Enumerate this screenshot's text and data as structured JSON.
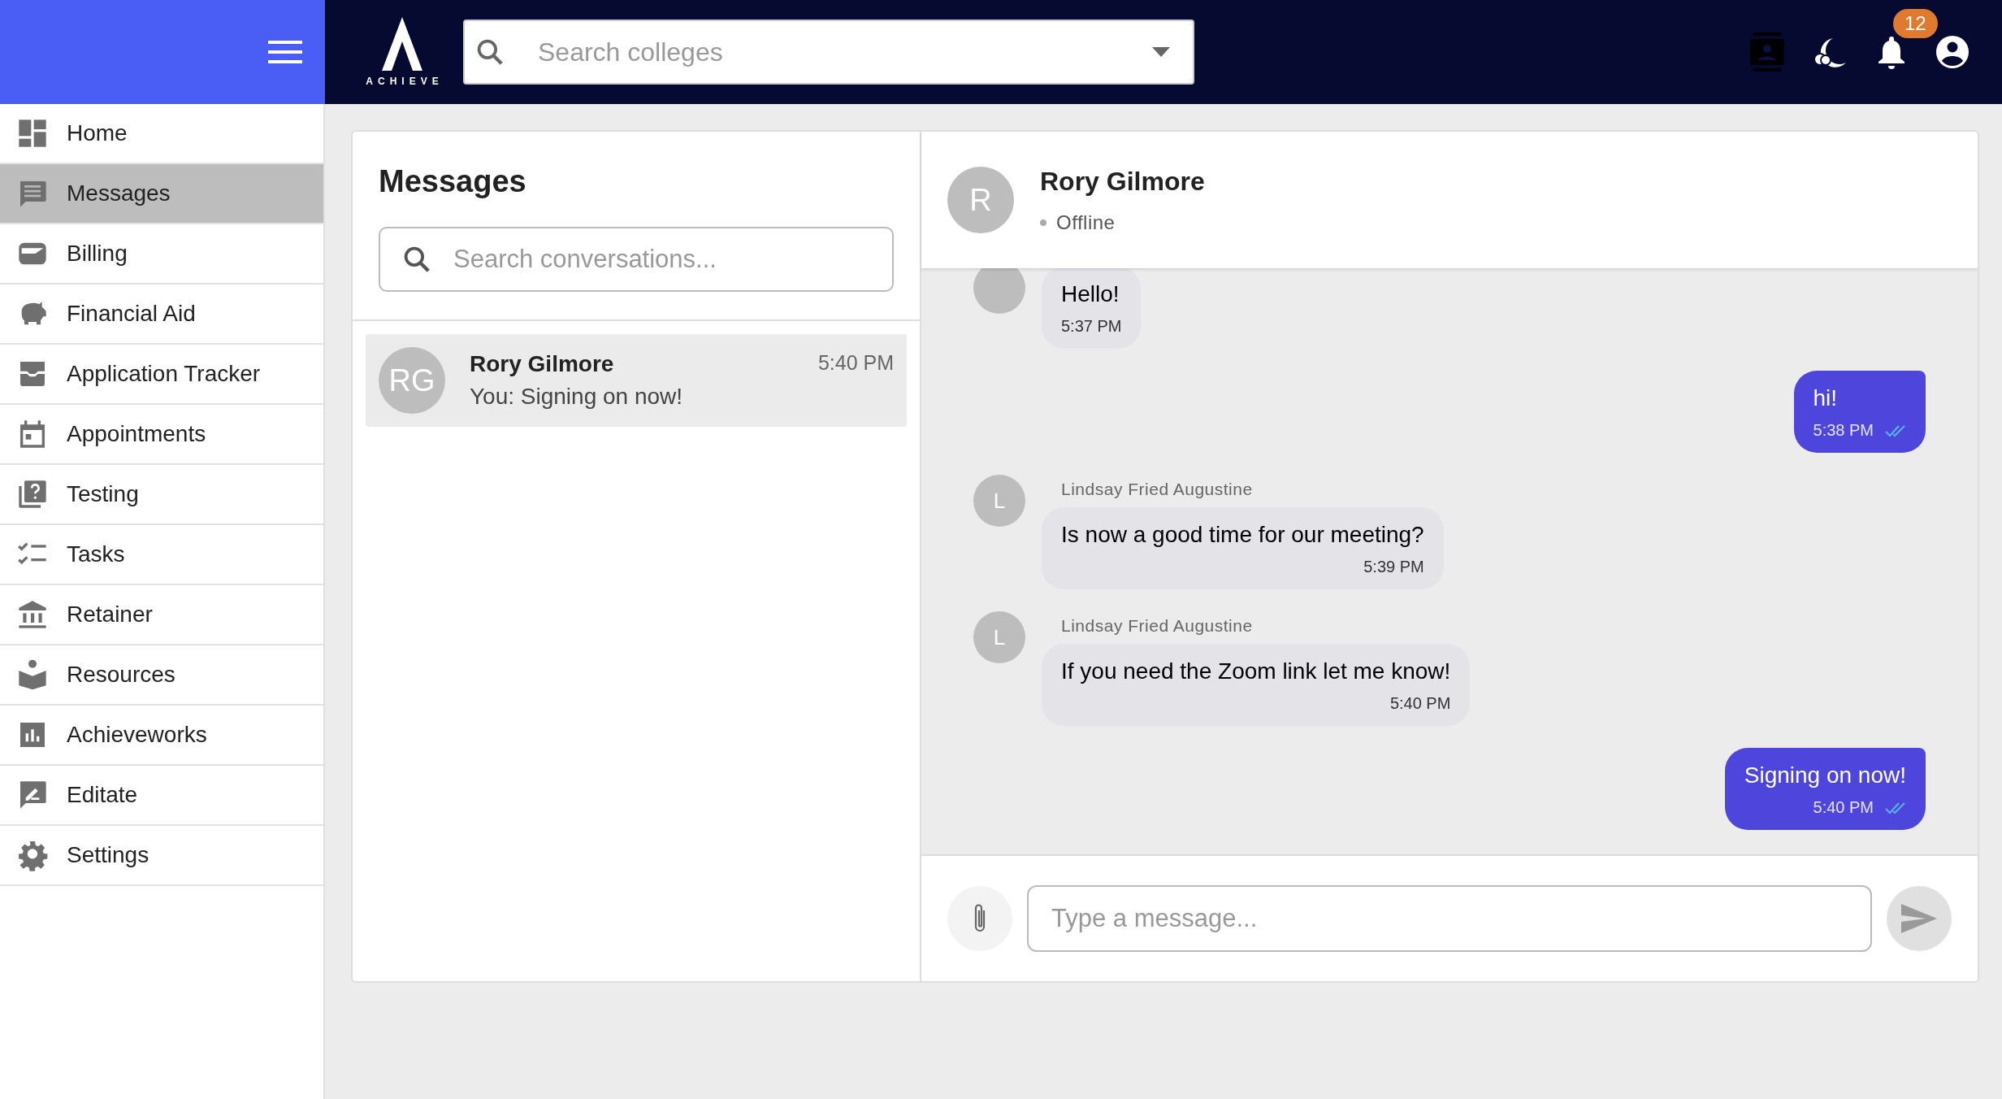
{
  "topbar": {
    "logo": "ACHIEVE",
    "search": {
      "placeholder": "Search colleges"
    },
    "notifications": {
      "count": "12"
    }
  },
  "sidebar": {
    "items": [
      {
        "label": "Home",
        "kind": "dashboard",
        "selected": false
      },
      {
        "label": "Messages",
        "kind": "chat",
        "selected": true
      },
      {
        "label": "Billing",
        "kind": "wallet",
        "selected": false
      },
      {
        "label": "Financial Aid",
        "kind": "piggy",
        "selected": false
      },
      {
        "label": "Application Tracker",
        "kind": "tray",
        "selected": false
      },
      {
        "label": "Appointments",
        "kind": "calendar",
        "selected": false
      },
      {
        "label": "Testing",
        "kind": "quiz",
        "selected": false
      },
      {
        "label": "Tasks",
        "kind": "checklist",
        "selected": false
      },
      {
        "label": "Retainer",
        "kind": "bank",
        "selected": false
      },
      {
        "label": "Resources",
        "kind": "reader",
        "selected": false
      },
      {
        "label": "Achieveworks",
        "kind": "chart",
        "selected": false
      },
      {
        "label": "Editate",
        "kind": "edit",
        "selected": false
      },
      {
        "label": "Settings",
        "kind": "gear",
        "selected": false
      }
    ]
  },
  "conversations": {
    "title": "Messages",
    "search": {
      "placeholder": "Search conversations..."
    },
    "items": [
      {
        "initials": "RG",
        "name": "Rory Gilmore",
        "time": "5:40 PM",
        "preview": "You: Signing on now!",
        "selected": true
      }
    ]
  },
  "chat": {
    "contact": {
      "initial": "R",
      "name": "Rory Gilmore",
      "status": "Offline"
    },
    "messages": [
      {
        "kind": "incoming",
        "text": "Hello!",
        "time": "5:37 PM"
      },
      {
        "kind": "outgoing",
        "text": "hi!",
        "time": "5:38 PM",
        "read": true
      },
      {
        "kind": "incoming",
        "initial": "L",
        "sender": "Lindsay Fried Augustine",
        "text": "Is now a good time for our meeting?",
        "time": "5:39 PM"
      },
      {
        "kind": "incoming",
        "initial": "L",
        "sender": "Lindsay Fried Augustine",
        "text": "If you need the Zoom link let me know!",
        "time": "5:40 PM"
      },
      {
        "kind": "outgoing",
        "text": "Signing on now!",
        "time": "5:40 PM",
        "read": true
      }
    ],
    "composer": {
      "placeholder": "Type a message..."
    }
  }
}
